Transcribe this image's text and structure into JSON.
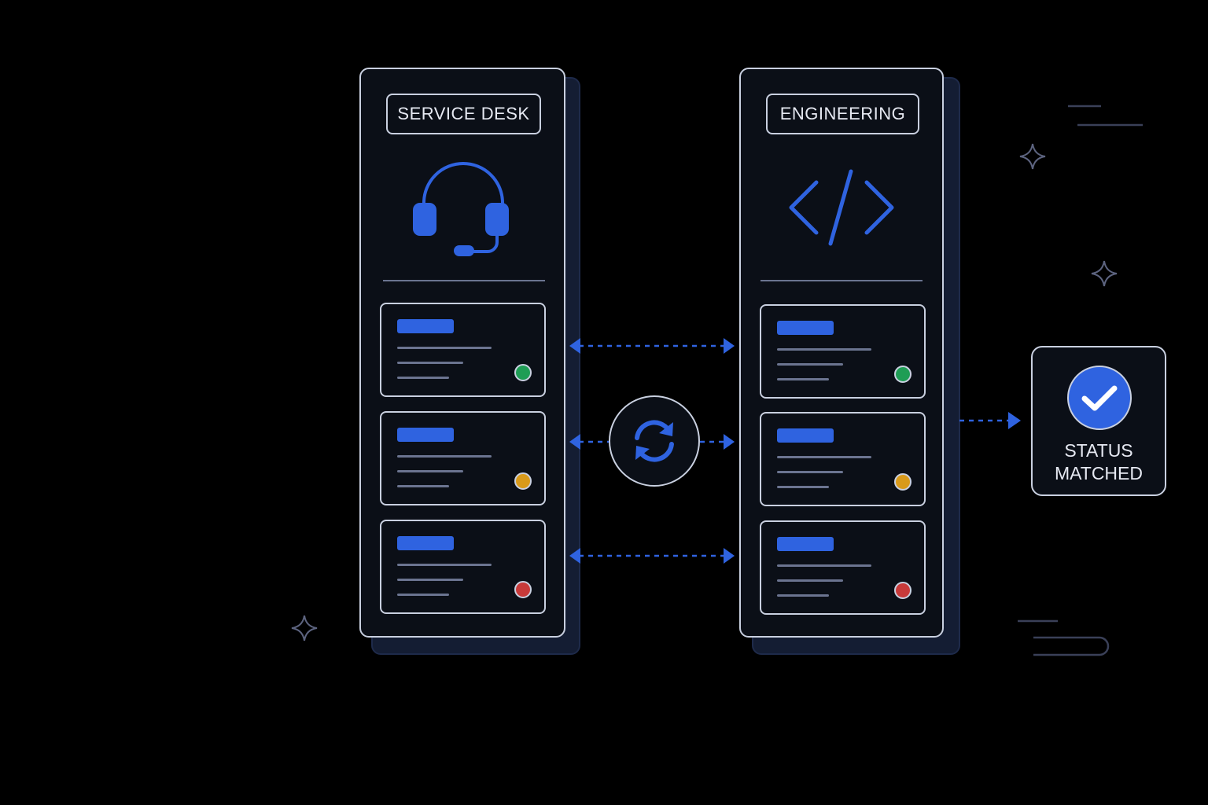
{
  "colors": {
    "background": "#000000",
    "panel_border": "#c9d0e0",
    "accent_blue": "#2f63e0",
    "status_green": "#1f9d55",
    "status_amber": "#d99a1a",
    "status_red": "#c83a3a"
  },
  "service_desk": {
    "title": "SERVICE DESK",
    "icon": "headset-icon",
    "tickets": [
      {
        "status_color": "green"
      },
      {
        "status_color": "amber"
      },
      {
        "status_color": "red"
      }
    ]
  },
  "engineering": {
    "title": "ENGINEERING",
    "icon": "code-icon",
    "tickets": [
      {
        "status_color": "green"
      },
      {
        "status_color": "amber"
      },
      {
        "status_color": "red"
      }
    ]
  },
  "sync": {
    "icon": "sync-icon"
  },
  "status": {
    "icon": "check-circle-icon",
    "line1": "STATUS",
    "line2": "MATCHED"
  },
  "decorations": {
    "icons": [
      "sparkle-icon",
      "sparkle-icon",
      "sparkle-icon"
    ]
  }
}
